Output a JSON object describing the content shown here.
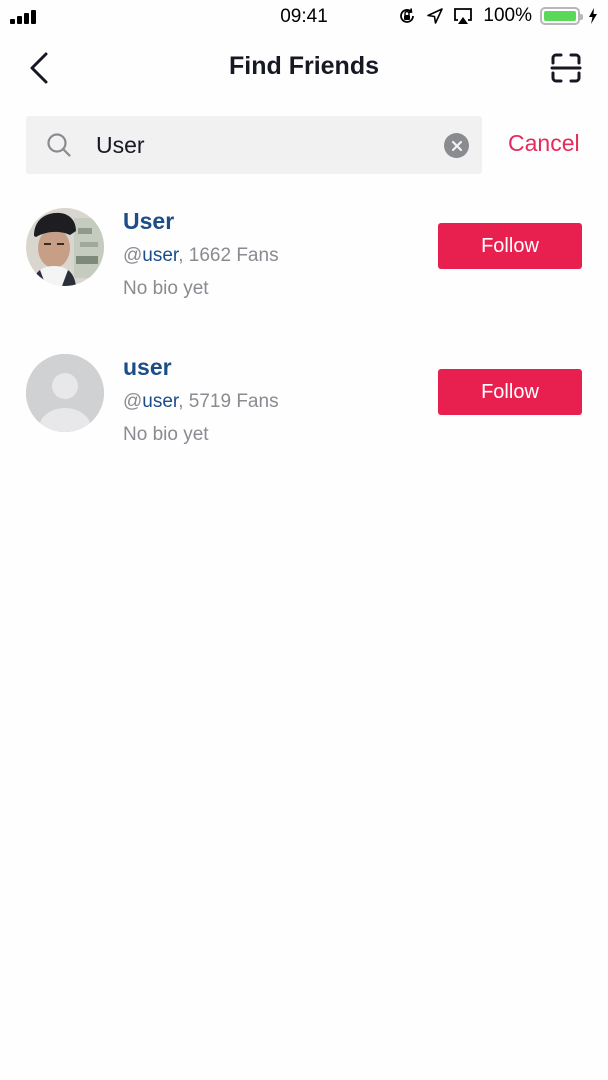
{
  "status_bar": {
    "time": "09:41",
    "battery_percent": "100%",
    "battery_level": 1.0,
    "icons": [
      "signal-icon",
      "orientation-lock-icon",
      "location-icon",
      "airplay-icon",
      "battery-icon",
      "charging-icon"
    ]
  },
  "header": {
    "title": "Find Friends",
    "back_icon": "chevron-left-icon",
    "scan_icon": "qr-scan-icon"
  },
  "search": {
    "value": "User",
    "placeholder": "Search",
    "cancel_label": "Cancel",
    "clear_icon": "clear-icon"
  },
  "results": [
    {
      "display_name": "User",
      "at": "@",
      "handle": "user",
      "fans_text": ", 1662 Fans",
      "bio": "No bio yet",
      "follow_label": "Follow",
      "avatar": "photo"
    },
    {
      "display_name": "user",
      "at": "@",
      "handle": "user",
      "fans_text": ", 5719 Fans",
      "bio": "No bio yet",
      "follow_label": "Follow",
      "avatar": "default"
    }
  ],
  "colors": {
    "accent": "#e8204f",
    "cancel": "#e52b5a",
    "link": "#1c4d86",
    "secondary_text": "#8a8b91",
    "search_bg": "#f1f1f2"
  }
}
